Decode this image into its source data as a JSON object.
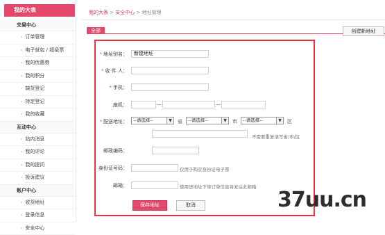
{
  "sidebar": {
    "title": "我的大表",
    "sections": [
      {
        "label": "交易中心",
        "items": [
          "订单管理",
          "电子就包 / 超级票",
          "我的优惠券",
          "我的积分",
          "缺货登记",
          "持定登记",
          "我的收藏"
        ]
      },
      {
        "label": "互动中心",
        "items": [
          "站内消息",
          "我的评论",
          "我的提问",
          "投诉建议"
        ]
      },
      {
        "label": "账户中心",
        "items": [
          "收货地址",
          "登录信息",
          "安全中心"
        ]
      }
    ]
  },
  "breadcrumb": {
    "home": "我的大表",
    "sep1": " > ",
    "section": "安全中心",
    "sep2": " > ",
    "current": "地址管理"
  },
  "toolbar": {
    "tab_all": "全部",
    "create_button": "创建新地址"
  },
  "form": {
    "alias_label": "地址别名：",
    "alias_value": "新建地址",
    "receiver_label": "收 件 人：",
    "mobile_label": "手机：",
    "phone_label": "座机：",
    "phone_sep1": "—",
    "phone_sep2": "—",
    "address_label": "配送地址：",
    "province_select": "--请选择--",
    "province_unit": "省",
    "city_select": "--请选择--",
    "city_unit": "市",
    "district_select": "--请选择--",
    "district_unit": "区",
    "address_hint": "不需要重复填写省/市/区",
    "zip_label": "邮政编码：",
    "id_label": "身份证号码：",
    "id_hint": "仅用于购买身份证电子票",
    "email_label": "邮箱：",
    "email_hint": "使用该地址下单订单信息将发往此邮箱",
    "save_button": "保存地址",
    "cancel_button": "取消"
  },
  "watermark": "37uu.cn",
  "colors": {
    "accent": "#e4486b",
    "panel_border": "#e8333f"
  }
}
